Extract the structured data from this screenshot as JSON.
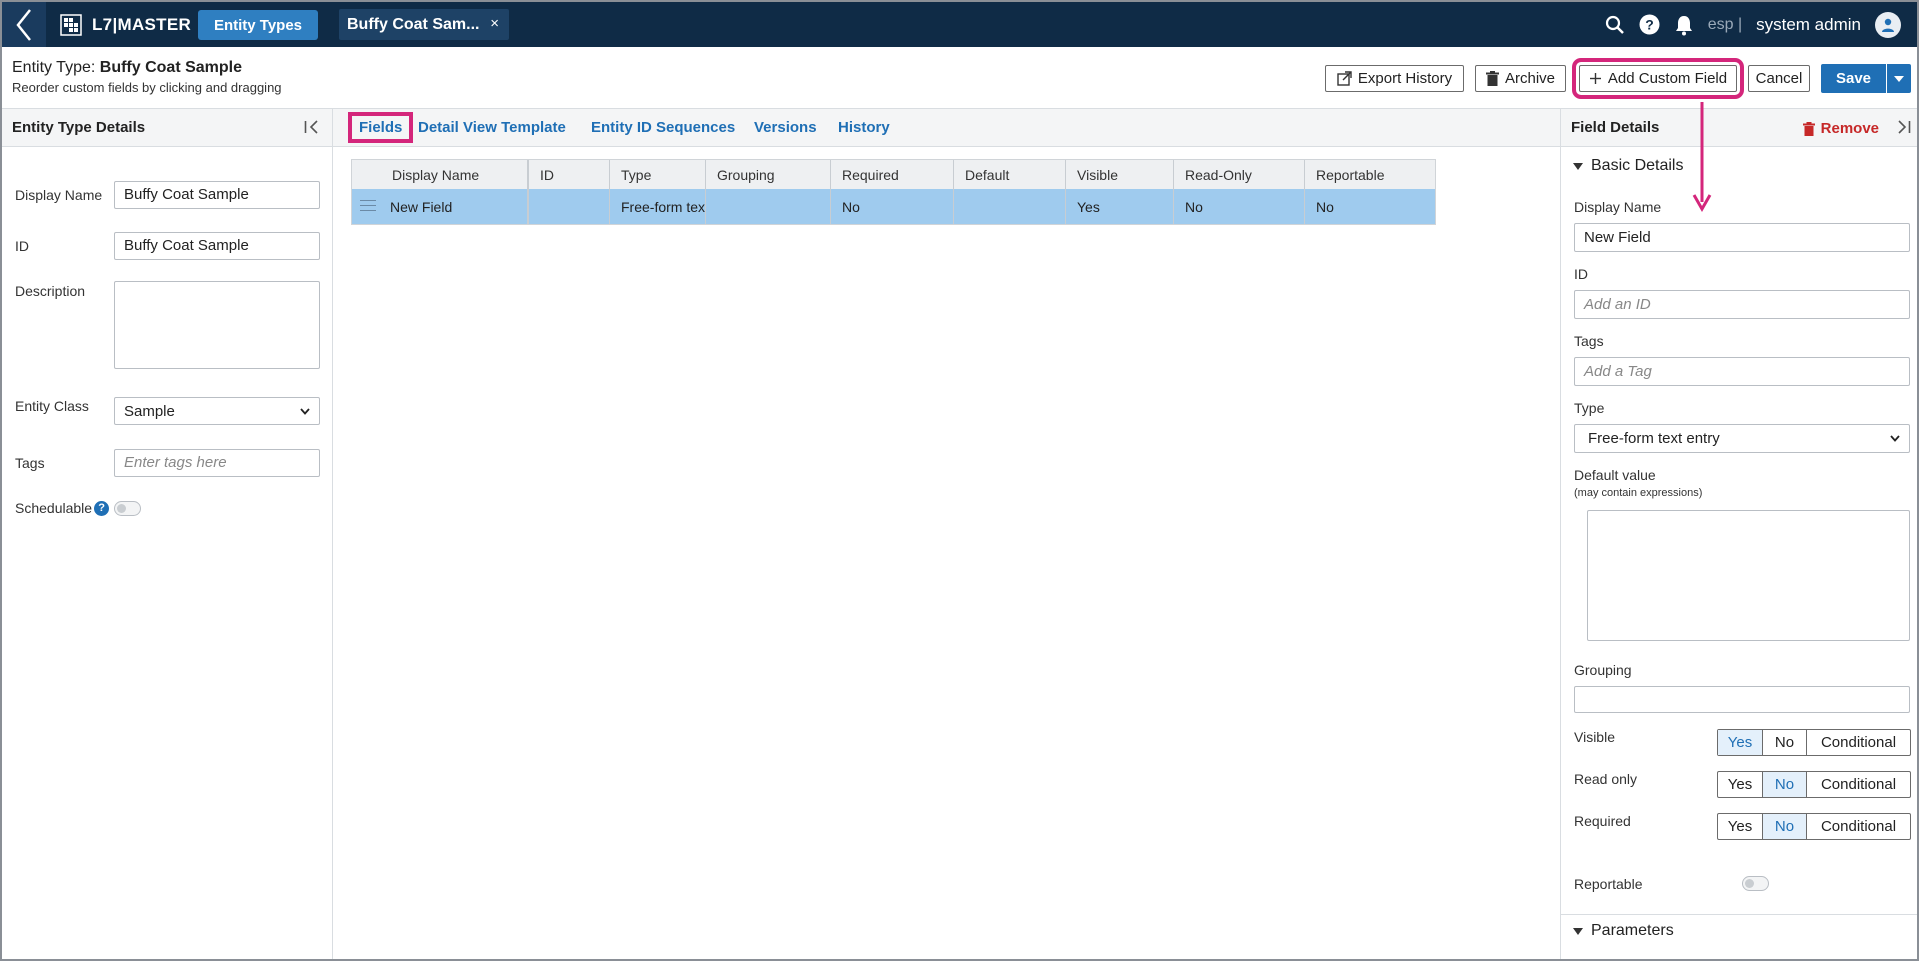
{
  "topbar": {
    "app_name": "L7|MASTER",
    "nav_label": "Entity Types",
    "doc_tab_label": "Buffy Coat Sam...",
    "close_glyph": "×",
    "lang": "esp |",
    "user_name": "system admin",
    "icons": [
      "back-chevron-icon",
      "app-logo-icon",
      "search-icon",
      "help-icon",
      "bell-icon",
      "user-icon"
    ]
  },
  "header": {
    "prefix": "Entity Type:",
    "name": "Buffy Coat Sample",
    "subtitle": "Reorder custom fields by clicking and dragging",
    "buttons": {
      "export": "Export History",
      "archive": "Archive",
      "add": "Add Custom Field",
      "cancel": "Cancel",
      "save": "Save"
    }
  },
  "left_panel": {
    "title": "Entity Type Details",
    "display_name_label": "Display Name",
    "display_name_value": "Buffy Coat Sample",
    "id_label": "ID",
    "id_value": "Buffy Coat Sample",
    "description_label": "Description",
    "description_value": "",
    "entity_class_label": "Entity Class",
    "entity_class_value": "Sample",
    "tags_label": "Tags",
    "tags_placeholder": "Enter tags here",
    "schedulable_label": "Schedulable",
    "help_glyph": "?",
    "schedulable_on": false
  },
  "tabs": [
    "Fields",
    "Detail View Template",
    "Entity ID Sequences",
    "Versions",
    "History"
  ],
  "grid": {
    "columns": [
      "Display Name",
      "ID",
      "Type",
      "Grouping",
      "Required",
      "Default",
      "Visible",
      "Read-Only",
      "Reportable"
    ],
    "rows": [
      [
        "New Field",
        "",
        "Free-form tex",
        "",
        "No",
        "",
        "Yes",
        "No",
        "No"
      ]
    ]
  },
  "right_panel": {
    "title": "Field Details",
    "remove_label": "Remove",
    "section_basic": "Basic Details",
    "display_name_label": "Display Name",
    "display_name_value": "New Field",
    "id_label": "ID",
    "id_placeholder": "Add an ID",
    "tags_label": "Tags",
    "tags_placeholder": "Add a Tag",
    "type_label": "Type",
    "type_value": "Free-form text entry",
    "default_label": "Default value",
    "default_hint": "(may contain expressions)",
    "grouping_label": "Grouping",
    "visible_label": "Visible",
    "readonly_label": "Read only",
    "required_label": "Required",
    "seg_yes": "Yes",
    "seg_no": "No",
    "seg_conditional": "Conditional",
    "visible_selected": "Yes",
    "readonly_selected": "No",
    "required_selected": "No",
    "reportable_label": "Reportable",
    "reportable_on": false,
    "section_params": "Parameters"
  },
  "colors": {
    "topbar": "#0f2b46",
    "accent": "#1f6fb5",
    "highlight": "#d4267b",
    "selected_row": "#9fcbee",
    "danger": "#c62828"
  }
}
